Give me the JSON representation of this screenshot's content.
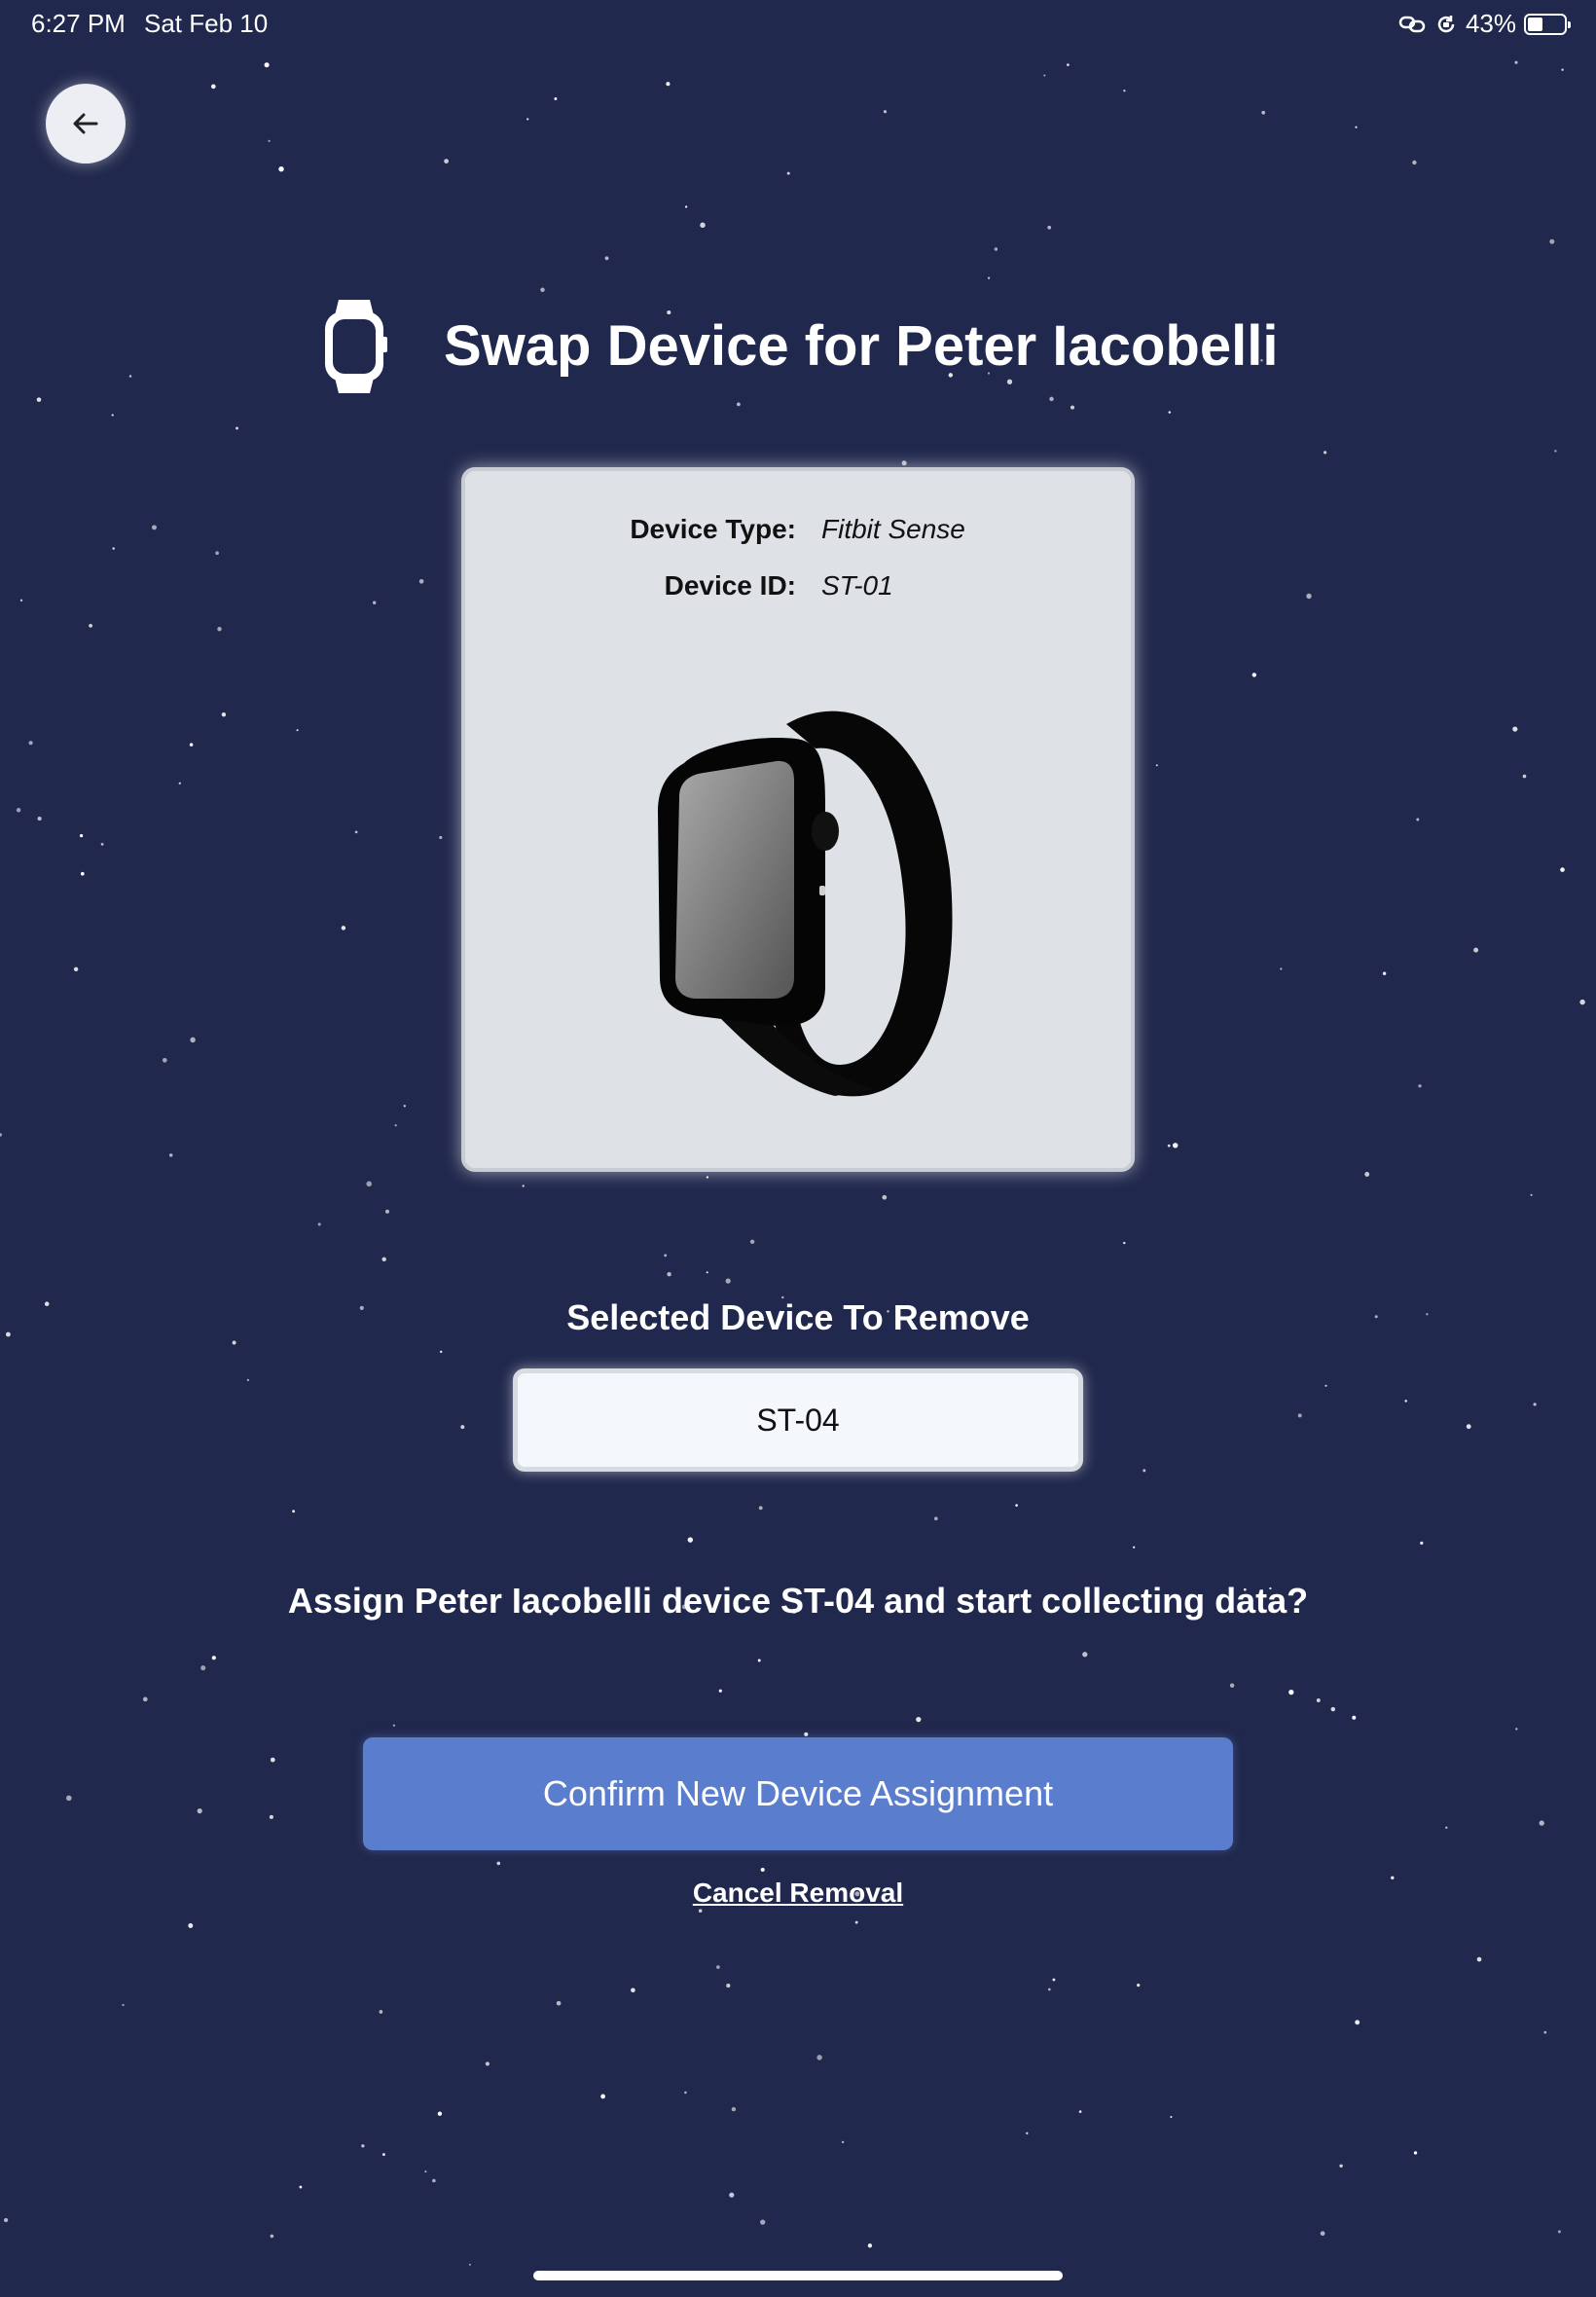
{
  "status_bar": {
    "time": "6:27 PM",
    "date": "Sat Feb 10",
    "battery_percent": "43%",
    "battery_level": 0.43,
    "icons": [
      "link-icon",
      "orientation-lock-icon",
      "battery-icon"
    ]
  },
  "header": {
    "back_icon": "arrow-left-icon",
    "title_icon": "watch-icon",
    "title": "Swap Device for Peter Iacobelli"
  },
  "device_card": {
    "type_label": "Device Type:",
    "type_value": "Fitbit Sense",
    "id_label": "Device ID:",
    "id_value": "ST-01",
    "image": "smartwatch-image"
  },
  "selection": {
    "label": "Selected Device To Remove",
    "value": "ST-04"
  },
  "prompt": "Assign Peter Iacobelli device ST-04 and start collecting data?",
  "actions": {
    "confirm_label": "Confirm New Device Assignment",
    "cancel_label": "Cancel Removal"
  },
  "colors": {
    "background": "#20284d",
    "card": "#dee1e6",
    "field": "#f4f8fc",
    "primary_button": "#5a7dce",
    "text_light": "#ffffff",
    "text_dark": "#111111"
  }
}
